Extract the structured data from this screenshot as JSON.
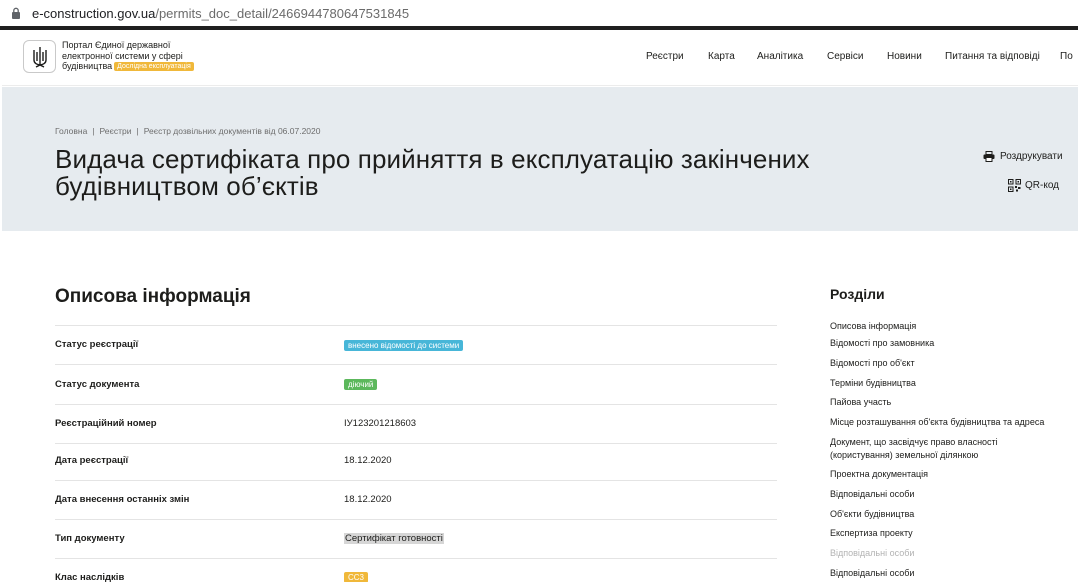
{
  "browser": {
    "url_host": "e-construction.gov.ua",
    "url_path": "/permits_doc_detail/2466944780647531845"
  },
  "header": {
    "portal_line1": "Портал Єдиної державної",
    "portal_line2": "електронної системи у сфері",
    "portal_line3": "будівництва",
    "badge": "Дослідна експлуатація",
    "nav": [
      "Реєстри",
      "Карта",
      "Аналітика",
      "Сервіси",
      "Новини",
      "Питання та відповіді",
      "По"
    ]
  },
  "hero": {
    "breadcrumb": [
      "Головна",
      "Реєстри",
      "Реєстр дозвільних документів від 06.07.2020"
    ],
    "title_line1": "Видача сертифіката про прийняття в експлуатацію закінчених",
    "title_line2": "будівництвом об’єктів",
    "print_label": "Роздрукувати",
    "qr_label": "QR-код"
  },
  "main": {
    "section_title": "Описова інформація",
    "rows": [
      {
        "label": "Статус реєстрації",
        "value": "внесено відомості до системи"
      },
      {
        "label": "Статус документа",
        "value": "діючий"
      },
      {
        "label": "Реєстраційний номер",
        "value": "ІУ123201218603"
      },
      {
        "label": "Дата реєстрації",
        "value": "18.12.2020"
      },
      {
        "label": "Дата внесення останніх змін",
        "value": "18.12.2020"
      },
      {
        "label": "Тип документу",
        "value": "Сертифікат готовності"
      },
      {
        "label": "Клас наслідків",
        "value": "СС3"
      }
    ]
  },
  "sidebar": {
    "title": "Розділи",
    "items": [
      "Описова інформація",
      "Відомості про замовника",
      "Відомості про об'єкт",
      "Терміни будівництва",
      "Пайова участь",
      "Місце розташування об'єкта будівництва та адреса",
      "Документ, що засвідчує право власності",
      "(користування) земельної ділянкою",
      "Проектна документація",
      "Відповідальні особи",
      "Об'єкти будівництва",
      "Експертиза проекту",
      "Відповідальні особи",
      "Відповідальні особи"
    ]
  },
  "colors": {
    "hero_bg": "#e6ebef",
    "status_blue": "#47b6d8",
    "status_green": "#5cb85c",
    "badge_orange": "#f0b83a"
  }
}
